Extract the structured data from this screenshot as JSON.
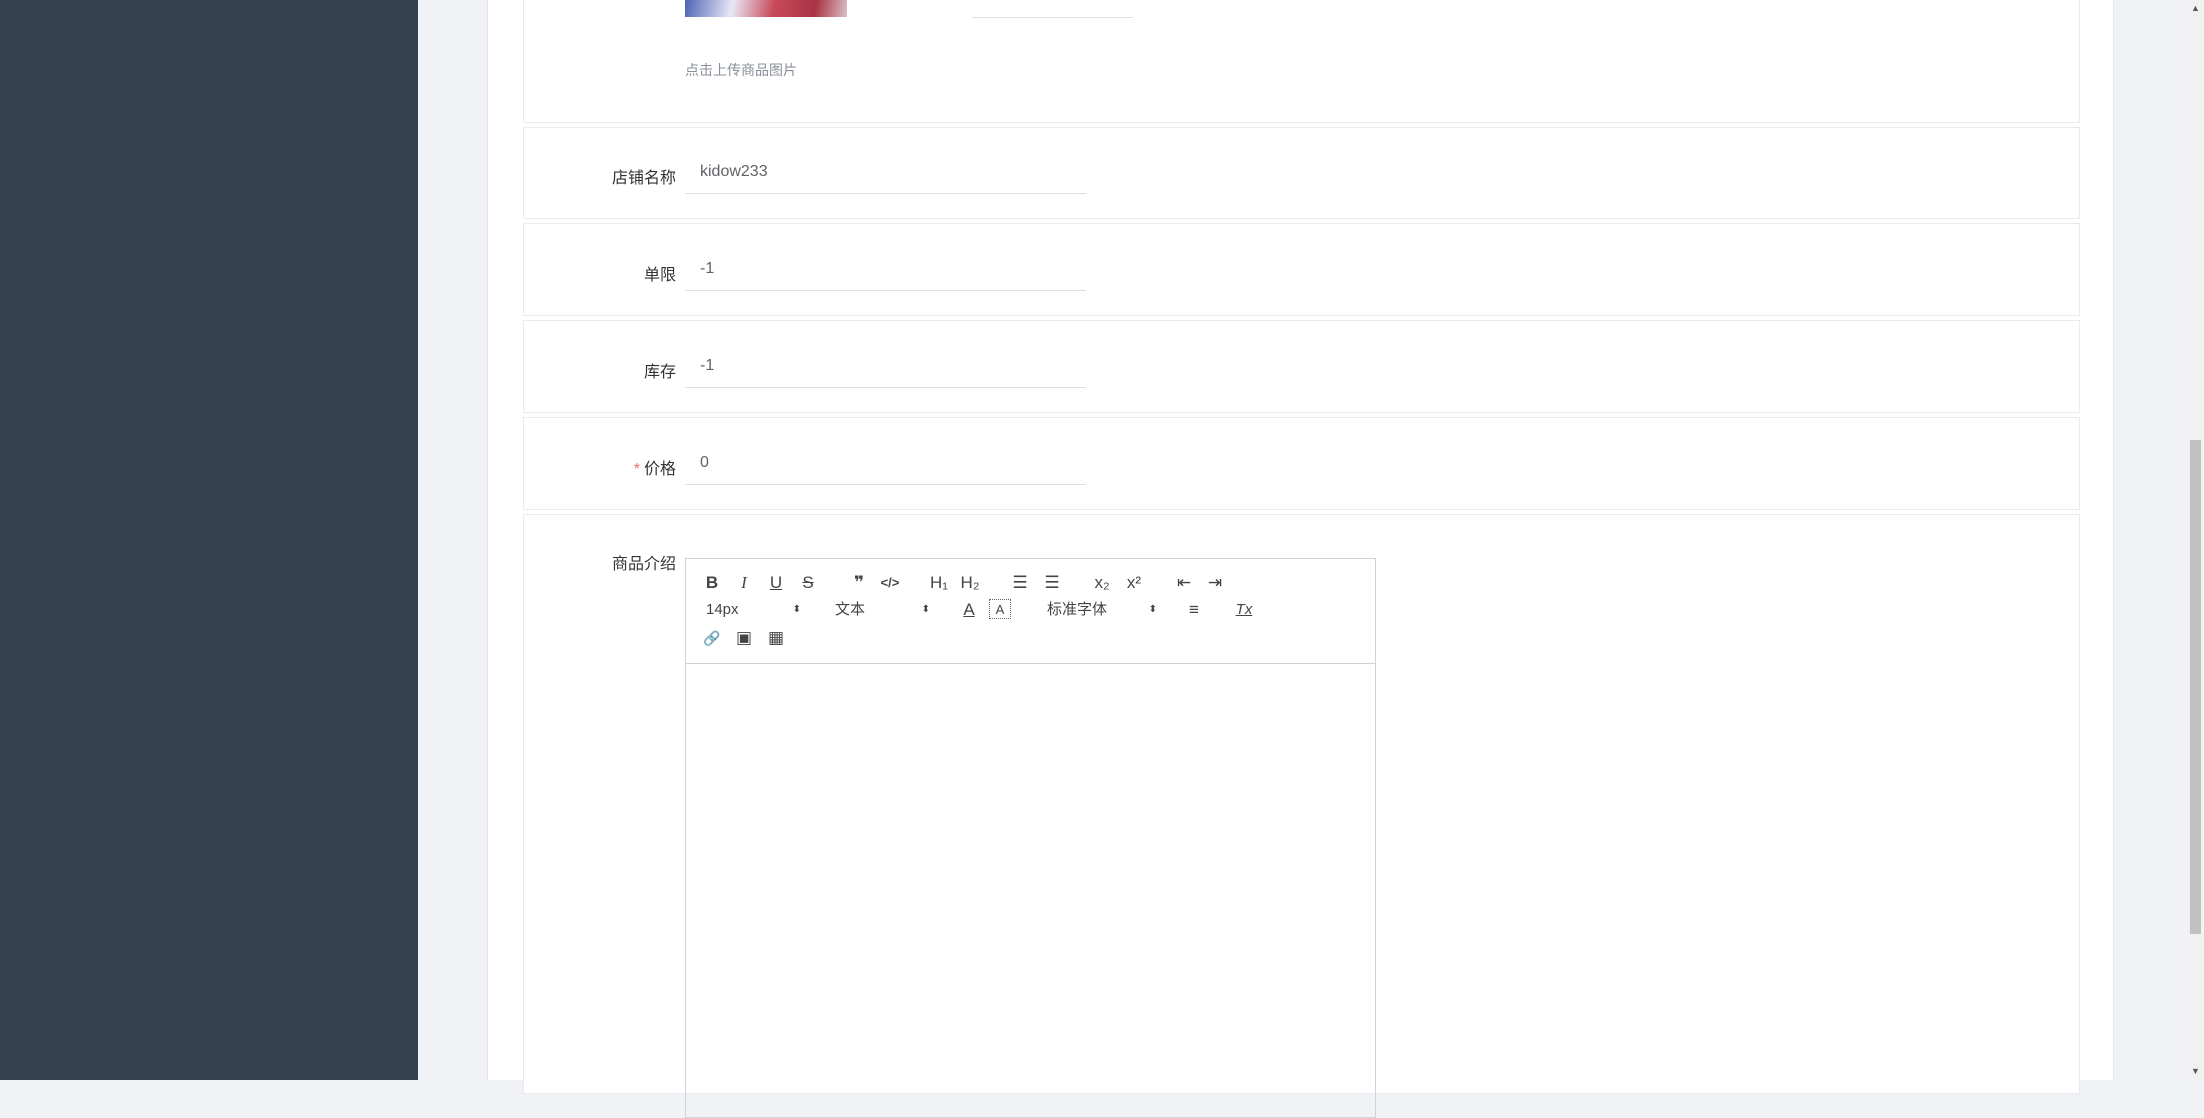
{
  "upload": {
    "hint": "点击上传商品图片"
  },
  "form": {
    "shop_name": {
      "label": "店铺名称",
      "value": "kidow233"
    },
    "limit": {
      "label": "单限",
      "value": "-1"
    },
    "stock": {
      "label": "库存",
      "value": "-1"
    },
    "price": {
      "label": "价格",
      "required_mark": "*",
      "value": "0"
    },
    "intro": {
      "label": "商品介绍"
    }
  },
  "editor": {
    "font_size": "14px",
    "header_select": "文本",
    "font_family": "标准字体",
    "buttons": {
      "bold": "B",
      "italic": "I",
      "underline": "U",
      "strike": "S",
      "quote": "❞",
      "code": "</>",
      "h1": "H₁",
      "h2": "H₂",
      "ordered_list": "☰",
      "bullet_list": "☰",
      "subscript": "x₂",
      "superscript": "x²",
      "outdent": "⇤",
      "indent": "⇥",
      "text_color": "A",
      "background_color": "A",
      "align": "≡",
      "clean": "Tx",
      "link": "🔗",
      "image": "▣",
      "video": "▦"
    },
    "select_arrow": "⬍"
  },
  "icons": {
    "bold": "bold-icon",
    "italic": "italic-icon",
    "underline": "underline-icon",
    "strike": "strikethrough-icon",
    "quote": "blockquote-icon",
    "code": "code-block-icon",
    "h1": "header-1-icon",
    "h2": "header-2-icon",
    "ordered": "ordered-list-icon",
    "bullet": "bullet-list-icon",
    "sub": "subscript-icon",
    "sup": "superscript-icon",
    "outdent": "outdent-icon",
    "indent": "indent-icon",
    "color": "text-color-icon",
    "bg": "background-color-icon",
    "align": "align-icon",
    "clean": "clear-format-icon",
    "link": "link-icon",
    "image": "image-icon",
    "video": "video-icon"
  },
  "colors": {
    "sidebar_bg": "#364150",
    "required": "#f56c6c",
    "page_bg": "#f0f2f5"
  }
}
